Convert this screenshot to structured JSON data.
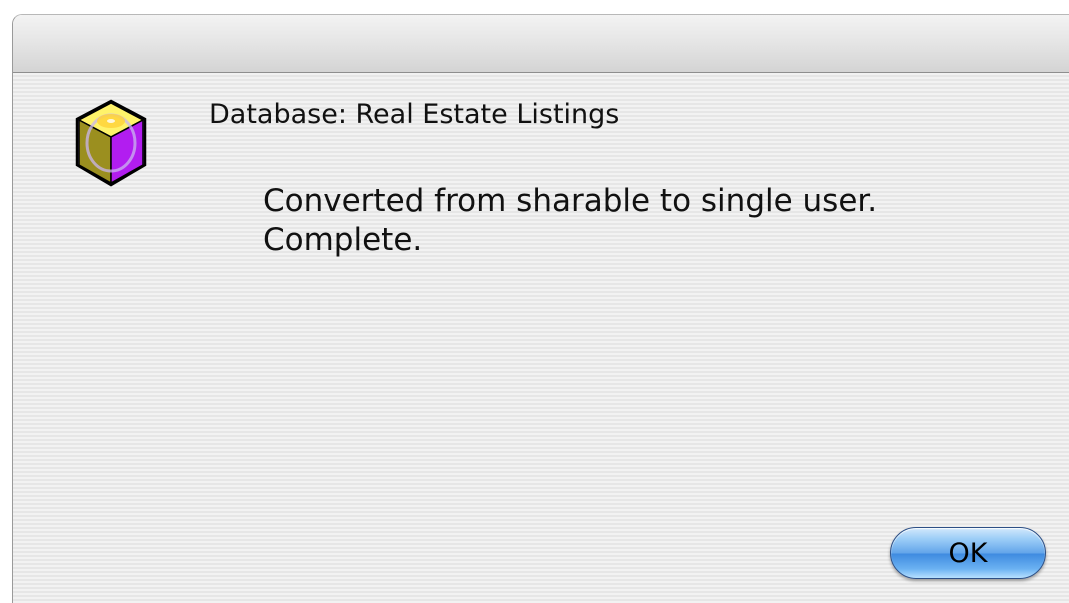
{
  "dialog": {
    "icon": "database-cube-icon",
    "database_title": "Database: Real Estate Listings",
    "message_line_1": "Converted from sharable to single user.",
    "message_line_2": "Complete.",
    "ok_label": "OK"
  },
  "colors": {
    "button_accent": "#63a5ea",
    "background_stripe_light": "#f2f2f2",
    "background_stripe_dark": "#e6e6e6"
  }
}
